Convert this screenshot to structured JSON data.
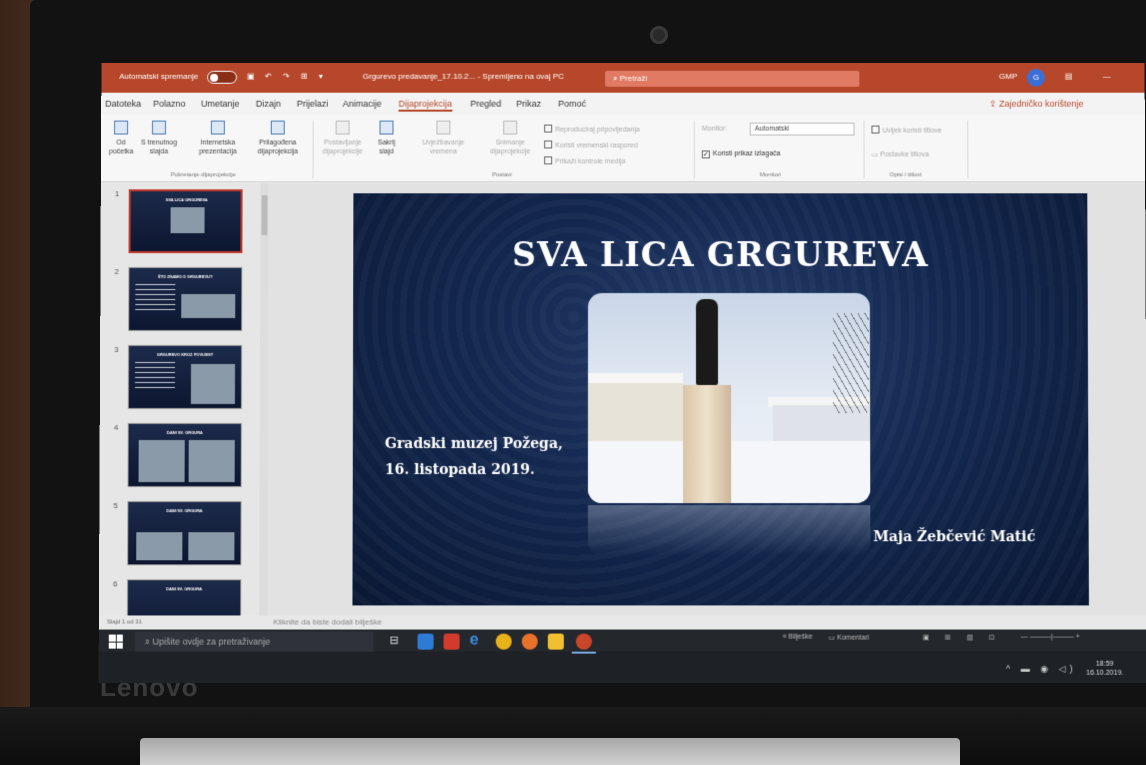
{
  "titlebar": {
    "autosave_label": "Automatski spremanje",
    "file_title": "Grgurevo predavanje_17.10.2... - Spremljeno na ovaj PC",
    "search_placeholder": "Pretraži",
    "user_initials": "GMP"
  },
  "tabs": [
    "Datoteka",
    "Polazno",
    "Umetanje",
    "Dizajn",
    "Prijelazi",
    "Animacije",
    "Dijaprojekcija",
    "Pregled",
    "Prikaz",
    "Pomoć"
  ],
  "active_tab": "Dijaprojekcija",
  "share_label": "Zajedničko korištenje",
  "ribbon": {
    "start_group": {
      "label": "Pokretanje dijaprojekcije",
      "buttons": [
        "Od početka",
        "S trenutnog slajda",
        "Internetska prezentacija",
        "Prilagođena dijaprojekcija"
      ]
    },
    "setup_group": {
      "label": "Postavi",
      "buttons": [
        "Postavljanje dijaprojekcije",
        "Sakrij slajd",
        "Uvježbavanje vremena",
        "Snimanje dijaprojekcije"
      ],
      "options": [
        "Reproduciraj pripovijedanja",
        "Koristi vremenski raspored",
        "Prikaži kontrole medija"
      ]
    },
    "monitors_group": {
      "label": "Monitori",
      "monitor_label": "Monitor:",
      "monitor_value": "Automatski",
      "presenter_view": "Koristi prikaz izlagača"
    },
    "captions_group": {
      "label": "Opisi i titlovi",
      "options": [
        "Uvijek koristi titlove",
        "Postavke titlova"
      ]
    }
  },
  "slides": [
    {
      "num": "1",
      "title": "SVA LICA GRGUREVA"
    },
    {
      "num": "2",
      "title": "ŠTO ZNAMO O GRGUREVU?"
    },
    {
      "num": "3",
      "title": "GRGUREVO KROZ POVIJEST"
    },
    {
      "num": "4",
      "title": "DANI SV. GRGURA"
    },
    {
      "num": "5",
      "title": "DANI SV. GRGURA"
    },
    {
      "num": "6",
      "title": "DANI SV. GRGURA"
    }
  ],
  "main_slide": {
    "title": "SVA LICA GRGUREVA",
    "subtitle_line1": "Gradski muzej Požega,",
    "subtitle_line2": "16. listopada 2019.",
    "author": "Maja Žebčević Matić"
  },
  "notes_placeholder": "Kliknite da biste dodali bilješke",
  "status_bar": {
    "slide_count": "Slajd 1 od 31",
    "notes_btn": "Bilješke",
    "comments_btn": "Komentari"
  },
  "taskbar": {
    "search_placeholder": "Upišite ovdje za pretraživanje",
    "time": "18:59",
    "date": "16.10.2019."
  },
  "brand": "Lenovo",
  "colors": {
    "accent": "#b7472a",
    "slide_bg": "#142850"
  }
}
